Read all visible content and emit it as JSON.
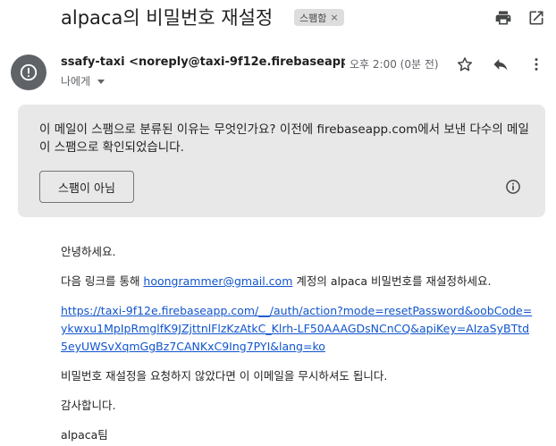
{
  "subject": {
    "title": "alpaca의 비밀번호 재설정",
    "label_chip": "스팸함",
    "chip_close": "×"
  },
  "header_icons": {
    "print": "print-icon",
    "open_new_window": "open-in-new-icon"
  },
  "message": {
    "sender": "ssafy-taxi <noreply@taxi-9f12e.firebaseapp...",
    "time": "오후 2:00 (0분 전)",
    "recipient": "나에게",
    "avatar_icon": "warning-icon",
    "actions": [
      "star-icon",
      "reply-icon",
      "more-vert-icon"
    ]
  },
  "spam_notice": {
    "text": "이 메일이 스팸으로 분류된 이유는 무엇인가요? 이전에 firebaseapp.com에서 보낸 다수의 메일이 스팸으로 확인되었습니다.",
    "button_label": "스팸이 아님",
    "info_icon": "info-icon"
  },
  "body": {
    "greeting": "안녕하세요.",
    "line1_before": "다음 링크를 통해 ",
    "email_link": "hoongrammer@gmail.com",
    "line1_after": " 계정의 alpaca 비밀번호를 재설정하세요.",
    "reset_link": "https://taxi-9f12e.firebaseapp.com/__/auth/action?mode=resetPassword&oobCode=ykwxu1MpIpRmglfK9JZjttnlFlzKzAtkC_Klrh-LF50AAAGDsNCnCQ&apiKey=AIzaSyBTtd5eyUWSvXqmGgBz7CANKxC9Ing7PYI&lang=ko",
    "line2": "비밀번호 재설정을 요청하지 않았다면 이 이메일을 무시하셔도 됩니다.",
    "thanks": "감사합니다.",
    "signature": "alpaca팀"
  }
}
